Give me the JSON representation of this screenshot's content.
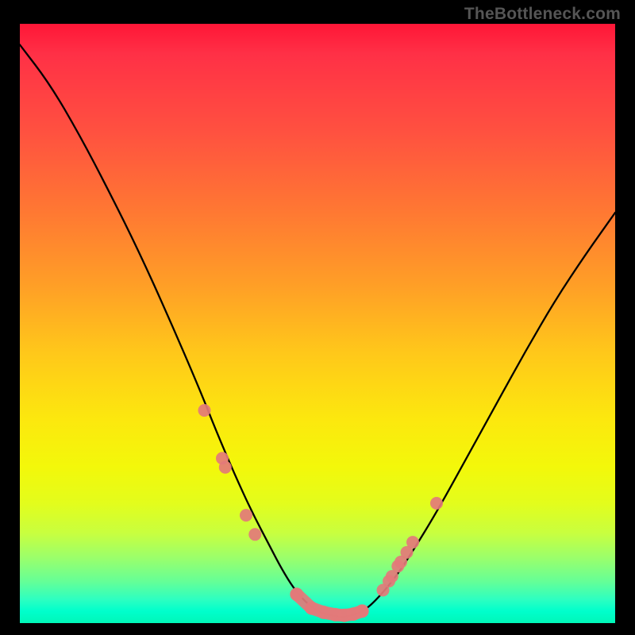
{
  "watermark": "TheBottleneck.com",
  "chart_data": {
    "type": "line",
    "title": "",
    "xlabel": "",
    "ylabel": "",
    "xlim": [
      0,
      1
    ],
    "ylim": [
      0,
      1
    ],
    "grid": false,
    "legend": false,
    "colors": {
      "gradient_top": "#ff1637",
      "gradient_mid1": "#ff7a32",
      "gradient_mid2": "#fce80e",
      "gradient_bottom": "#00f7b8",
      "curve": "#000000",
      "markers": "#e37a7a"
    },
    "series": [
      {
        "name": "curve",
        "x": [
          0.0,
          0.05,
          0.1,
          0.15,
          0.2,
          0.25,
          0.3,
          0.33,
          0.36,
          0.39,
          0.42,
          0.44,
          0.46,
          0.48,
          0.5,
          0.52,
          0.54,
          0.56,
          0.58,
          0.6,
          0.63,
          0.66,
          0.7,
          0.75,
          0.8,
          0.85,
          0.9,
          0.95,
          1.0
        ],
        "y": [
          0.965,
          0.9,
          0.815,
          0.72,
          0.62,
          0.51,
          0.395,
          0.32,
          0.25,
          0.185,
          0.128,
          0.09,
          0.058,
          0.035,
          0.02,
          0.013,
          0.01,
          0.013,
          0.022,
          0.04,
          0.075,
          0.12,
          0.185,
          0.275,
          0.365,
          0.455,
          0.54,
          0.615,
          0.685
        ]
      },
      {
        "name": "markers-left",
        "x": [
          0.31,
          0.34,
          0.345,
          0.38,
          0.395
        ],
        "y": [
          0.355,
          0.275,
          0.26,
          0.18,
          0.148
        ]
      },
      {
        "name": "markers-bottom",
        "x": [
          0.465,
          0.49,
          0.51,
          0.53,
          0.545,
          0.56,
          0.575
        ],
        "y": [
          0.048,
          0.025,
          0.018,
          0.014,
          0.013,
          0.015,
          0.02
        ]
      },
      {
        "name": "markers-right",
        "x": [
          0.61,
          0.62,
          0.625,
          0.635,
          0.64,
          0.65,
          0.66,
          0.7
        ],
        "y": [
          0.055,
          0.07,
          0.078,
          0.095,
          0.102,
          0.118,
          0.135,
          0.2
        ]
      }
    ]
  }
}
